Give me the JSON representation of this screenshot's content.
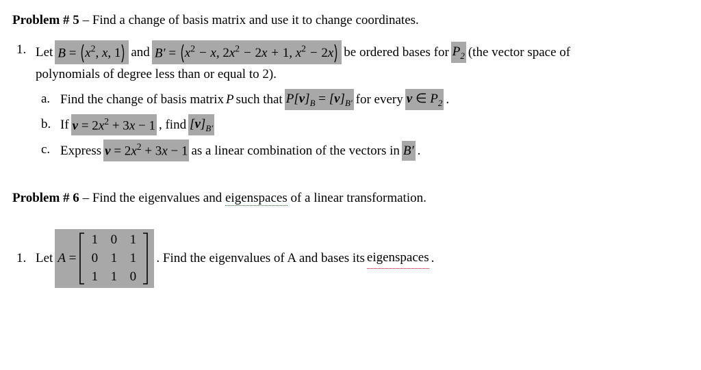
{
  "problem5": {
    "header_label": "Problem # 5",
    "header_sep": " – ",
    "header_text": "Find a change of basis matrix and use it to change coordinates.",
    "item1": {
      "num": "1.",
      "let_text": "Let ",
      "B_label": "B",
      "eq": " = ",
      "B_set_open": "(",
      "B_set_items": "x², x, 1",
      "B_set_close": ")",
      "and_text": " and ",
      "Bp_label": "B′",
      "Bp_set_items": "x² − x, 2x² − 2x + 1, x² − 2x",
      "be_text": " be ordered bases for ",
      "P2_label": "P",
      "P2_sub": "2",
      "space_text": " (the vector space of",
      "poly_line": "polynomials of degree less than or equal to 2).",
      "a": {
        "label": "a.",
        "t1": "Find the change of basis matrix ",
        "P": "P",
        "t2": " such that ",
        "expr_left": "P[v]",
        "sub_left": "B",
        "eq2": " = [v]",
        "sub_right": "B′",
        "t3": " for every ",
        "v_in": "v ∈ ",
        "P2b": "P",
        "P2b_sub": "2",
        "dot": "."
      },
      "b": {
        "label": "b.",
        "t1": "If ",
        "v_eq": "v = 2x² + 3x − 1",
        "t2": ", find ",
        "vB": "[v]",
        "vB_sub": "B′"
      },
      "c": {
        "label": "c.",
        "t1": "Express ",
        "v_eq": "v = 2x² + 3x − 1",
        "t2": " as a linear combination of the vectors in ",
        "Bp": "B′",
        "dot": "."
      }
    }
  },
  "problem6": {
    "header_label": "Problem # 6",
    "header_sep": " – ",
    "header_t1": "Find the eigenvalues and ",
    "eigenspaces": "eigenspaces",
    "header_t2": " of a linear transformation.",
    "item1": {
      "num": "1.",
      "let_text": "Let ",
      "A_eq": "A = ",
      "matrix": [
        [
          "1",
          "0",
          "1"
        ],
        [
          "0",
          "1",
          "1"
        ],
        [
          "1",
          "1",
          "0"
        ]
      ],
      "t_after": ".  Find the eigenvalues of A and bases its ",
      "eigenspaces": "eigenspaces",
      "dot": "."
    }
  }
}
